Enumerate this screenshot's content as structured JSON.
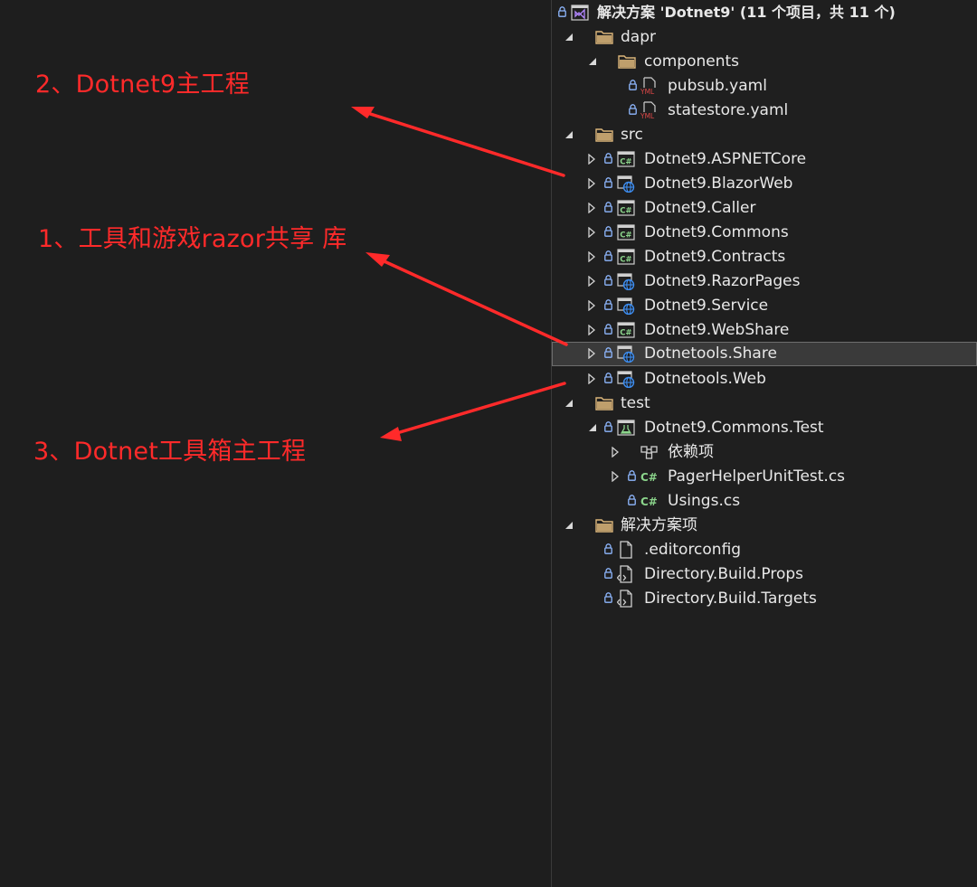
{
  "annotations": [
    {
      "text": "2、Dotnet9主工程"
    },
    {
      "text": "1、工具和游戏razor共享 库"
    },
    {
      "text": "3、Dotnet工具箱主工程"
    }
  ],
  "colors": {
    "annotation": "#ff2a2a",
    "background": "#1e1e1e",
    "folder": "#dcb67a",
    "csharp": "#8bd48b",
    "lock": "#8fb8ff",
    "web": "#3d8df0"
  },
  "tree": {
    "solution": "解决方案 'Dotnet9' (11 个项目，共 11 个)",
    "items": [
      {
        "label": "dapr",
        "icon": "folder-icon"
      },
      {
        "label": "components",
        "icon": "folder-icon"
      },
      {
        "label": "pubsub.yaml",
        "icon": "yaml-file-icon"
      },
      {
        "label": "statestore.yaml",
        "icon": "yaml-file-icon"
      },
      {
        "label": "src",
        "icon": "folder-icon"
      },
      {
        "label": "Dotnet9.ASPNETCore",
        "icon": "csharp-project-icon"
      },
      {
        "label": "Dotnet9.BlazorWeb",
        "icon": "web-project-icon"
      },
      {
        "label": "Dotnet9.Caller",
        "icon": "csharp-project-icon"
      },
      {
        "label": "Dotnet9.Commons",
        "icon": "csharp-project-icon"
      },
      {
        "label": "Dotnet9.Contracts",
        "icon": "csharp-project-icon"
      },
      {
        "label": "Dotnet9.RazorPages",
        "icon": "web-project-icon"
      },
      {
        "label": "Dotnet9.Service",
        "icon": "web-project-icon"
      },
      {
        "label": "Dotnet9.WebShare",
        "icon": "csharp-project-icon"
      },
      {
        "label": "Dotnetools.Share",
        "icon": "web-project-icon"
      },
      {
        "label": "Dotnetools.Web",
        "icon": "web-project-icon"
      },
      {
        "label": "test",
        "icon": "folder-icon"
      },
      {
        "label": "Dotnet9.Commons.Test",
        "icon": "test-project-icon"
      },
      {
        "label": "依赖项",
        "icon": "dependencies-icon"
      },
      {
        "label": "PagerHelperUnitTest.cs",
        "icon": "csharp-file-icon"
      },
      {
        "label": "Usings.cs",
        "icon": "csharp-file-icon"
      },
      {
        "label": "解决方案项",
        "icon": "folder-icon"
      },
      {
        "label": ".editorconfig",
        "icon": "file-icon"
      },
      {
        "label": "Directory.Build.Props",
        "icon": "build-file-icon"
      },
      {
        "label": "Directory.Build.Targets",
        "icon": "build-file-icon"
      }
    ]
  }
}
